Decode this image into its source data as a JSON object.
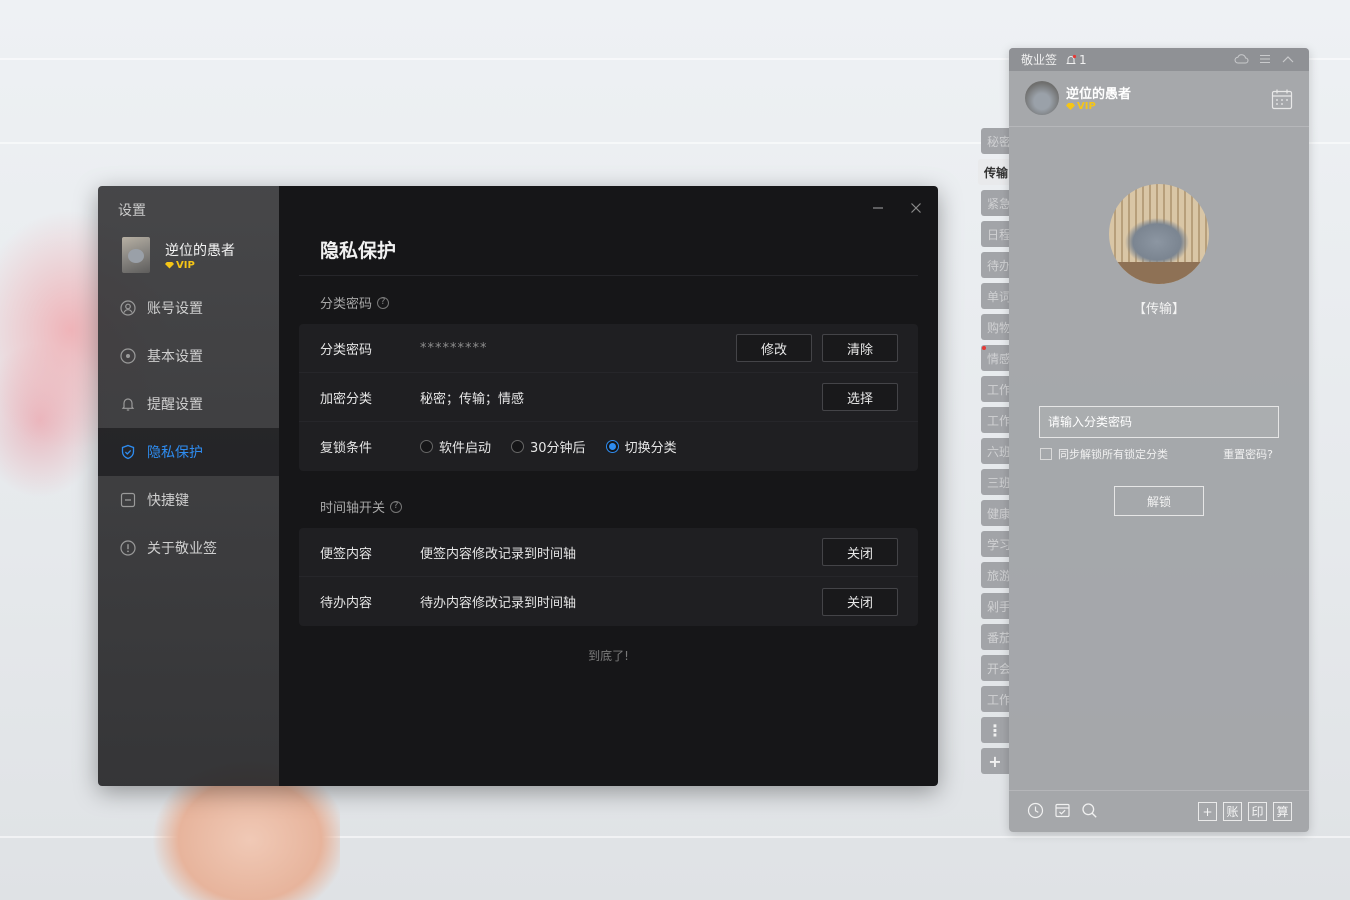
{
  "settings_window": {
    "title": "设置",
    "user": {
      "name": "逆位的愚者",
      "badge": "VIP"
    },
    "nav": [
      {
        "label": "账号设置",
        "icon": "user-icon"
      },
      {
        "label": "基本设置",
        "icon": "target-icon"
      },
      {
        "label": "提醒设置",
        "icon": "bell-icon"
      },
      {
        "label": "隐私保护",
        "icon": "shield-icon",
        "active": true
      },
      {
        "label": "快捷键",
        "icon": "keyboard-icon"
      },
      {
        "label": "关于敬业签",
        "icon": "info-icon"
      }
    ],
    "page_title": "隐私保护",
    "sections": {
      "category_password": {
        "label": "分类密码",
        "help": "?",
        "rows": {
          "password": {
            "label": "分类密码",
            "value": "*********",
            "buttons": [
              "修改",
              "清除"
            ]
          },
          "encrypted": {
            "label": "加密分类",
            "value": "秘密；传输；情感",
            "button": "选择"
          },
          "relock": {
            "label": "复锁条件",
            "options": [
              "软件启动",
              "30分钟后",
              "切换分类"
            ],
            "selected": "切换分类"
          }
        }
      },
      "timeline": {
        "label": "时间轴开关",
        "help": "?",
        "rows": [
          {
            "label": "便签内容",
            "value": "便签内容修改记录到时间轴",
            "button": "关闭"
          },
          {
            "label": "待办内容",
            "value": "待办内容修改记录到时间轴",
            "button": "关闭"
          }
        ]
      }
    },
    "bottom_note": "到底了!",
    "colors": {
      "accent": "#2e8cf0",
      "background": "#161618",
      "sidebar": "#2f2f31"
    }
  },
  "side_tabs": [
    {
      "label": "秘密"
    },
    {
      "label": "传输",
      "active": true
    },
    {
      "label": "紧急"
    },
    {
      "label": "日程"
    },
    {
      "label": "待办"
    },
    {
      "label": "单词"
    },
    {
      "label": "购物"
    },
    {
      "label": "情感",
      "dot": true
    },
    {
      "label": "工作"
    },
    {
      "label": "工作"
    },
    {
      "label": "六班"
    },
    {
      "label": "三班"
    },
    {
      "label": "健康"
    },
    {
      "label": "学习"
    },
    {
      "label": "旅游"
    },
    {
      "label": "剁手"
    },
    {
      "label": "番茄"
    },
    {
      "label": "开会"
    },
    {
      "label": "工作"
    }
  ],
  "side_tab_more": "⋮",
  "side_tab_add": "+",
  "note_widget": {
    "app_title": "敬业签",
    "bell_count": "1",
    "user": {
      "name": "逆位的愚者",
      "badge": "VIP"
    },
    "locked_category_label": "【传输】",
    "password_placeholder": "请输入分类密码",
    "sync_unlock_label": "同步解锁所有锁定分类",
    "reset_password_link": "重置密码?",
    "unlock_button": "解锁",
    "footer_right": [
      "+",
      "账",
      "印",
      "算"
    ]
  }
}
